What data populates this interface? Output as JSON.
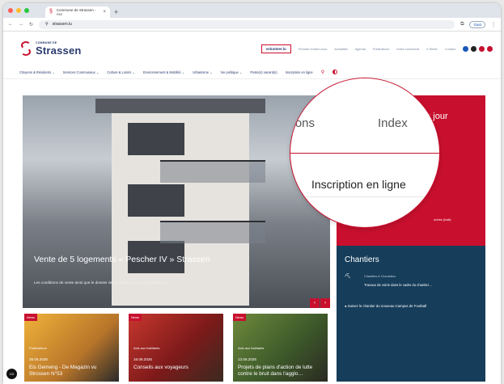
{
  "browser": {
    "tab_title": "Commune de Strassen - Acc",
    "new_tab": "+",
    "url": "strassen.lu",
    "guest_label": "Gast",
    "nav_icons": {
      "back": "←",
      "forward": "→",
      "reload": "↻"
    }
  },
  "site": {
    "logo_small": "COMMUNE DE",
    "logo_name": "Strassen",
    "volunteer_label": "volunteer.lu",
    "top_links": [
      "Prendre rendez-vous",
      "Actualités",
      "Agenda",
      "Publications",
      "Index communal",
      "e-Reder",
      "Contact"
    ],
    "social": [
      {
        "icon": "facebook-icon",
        "color": "#1a56b8"
      },
      {
        "icon": "instagram-icon",
        "color": "#222"
      },
      {
        "icon": "youtube-icon",
        "color": "#c8102e"
      },
      {
        "icon": "pinterest-icon",
        "color": "#c8102e"
      }
    ],
    "main_nav": [
      "Citoyens & Résidents ⌄",
      "Services Communaux ⌄",
      "Culture & Loisirs ⌄",
      "Environnement & Mobilité ⌄",
      "Urbanisme ⌄",
      "Vie politique ⌄",
      "Poste(s) vacant(s)",
      "Inscription en ligne"
    ]
  },
  "hero": {
    "title": "Vente de 5 logements « Pescher IV » Strassen",
    "subtitle": "Les conditions de vente ainsi que le dossier de candidature sont disponibles ici",
    "prev": "‹",
    "next": "›"
  },
  "sidebar_red": {
    "heading": "du jour",
    "line1": "ets",
    "line2": "uches (Icall)"
  },
  "sidebar_blue": {
    "heading": "Chantiers",
    "cat": "Chantiers & Circulation",
    "item": "Travaux de voirie dans le cadre du chantier…",
    "link": "Suivez le chantier du nouveau Campus de Football"
  },
  "magnifier": {
    "left_text": "ations",
    "right_text": "Index",
    "focus_text": "Inscription en ligne"
  },
  "cards": [
    {
      "tag": "News",
      "cat": "Publications",
      "date": "28.05.2025",
      "title": "Eis Gemeng - De Magazin vu Strossen N°53"
    },
    {
      "tag": "News",
      "cat": "Avis aux habitants",
      "date": "16.06.2025",
      "title": "Conseils aux voyageurs"
    },
    {
      "tag": "News",
      "cat": "Avis aux habitants",
      "date": "13.06.2025",
      "title": "Projets de plans d'action de lutte contre le bruit dans l'agglo…"
    }
  ],
  "cc_label": "CD"
}
